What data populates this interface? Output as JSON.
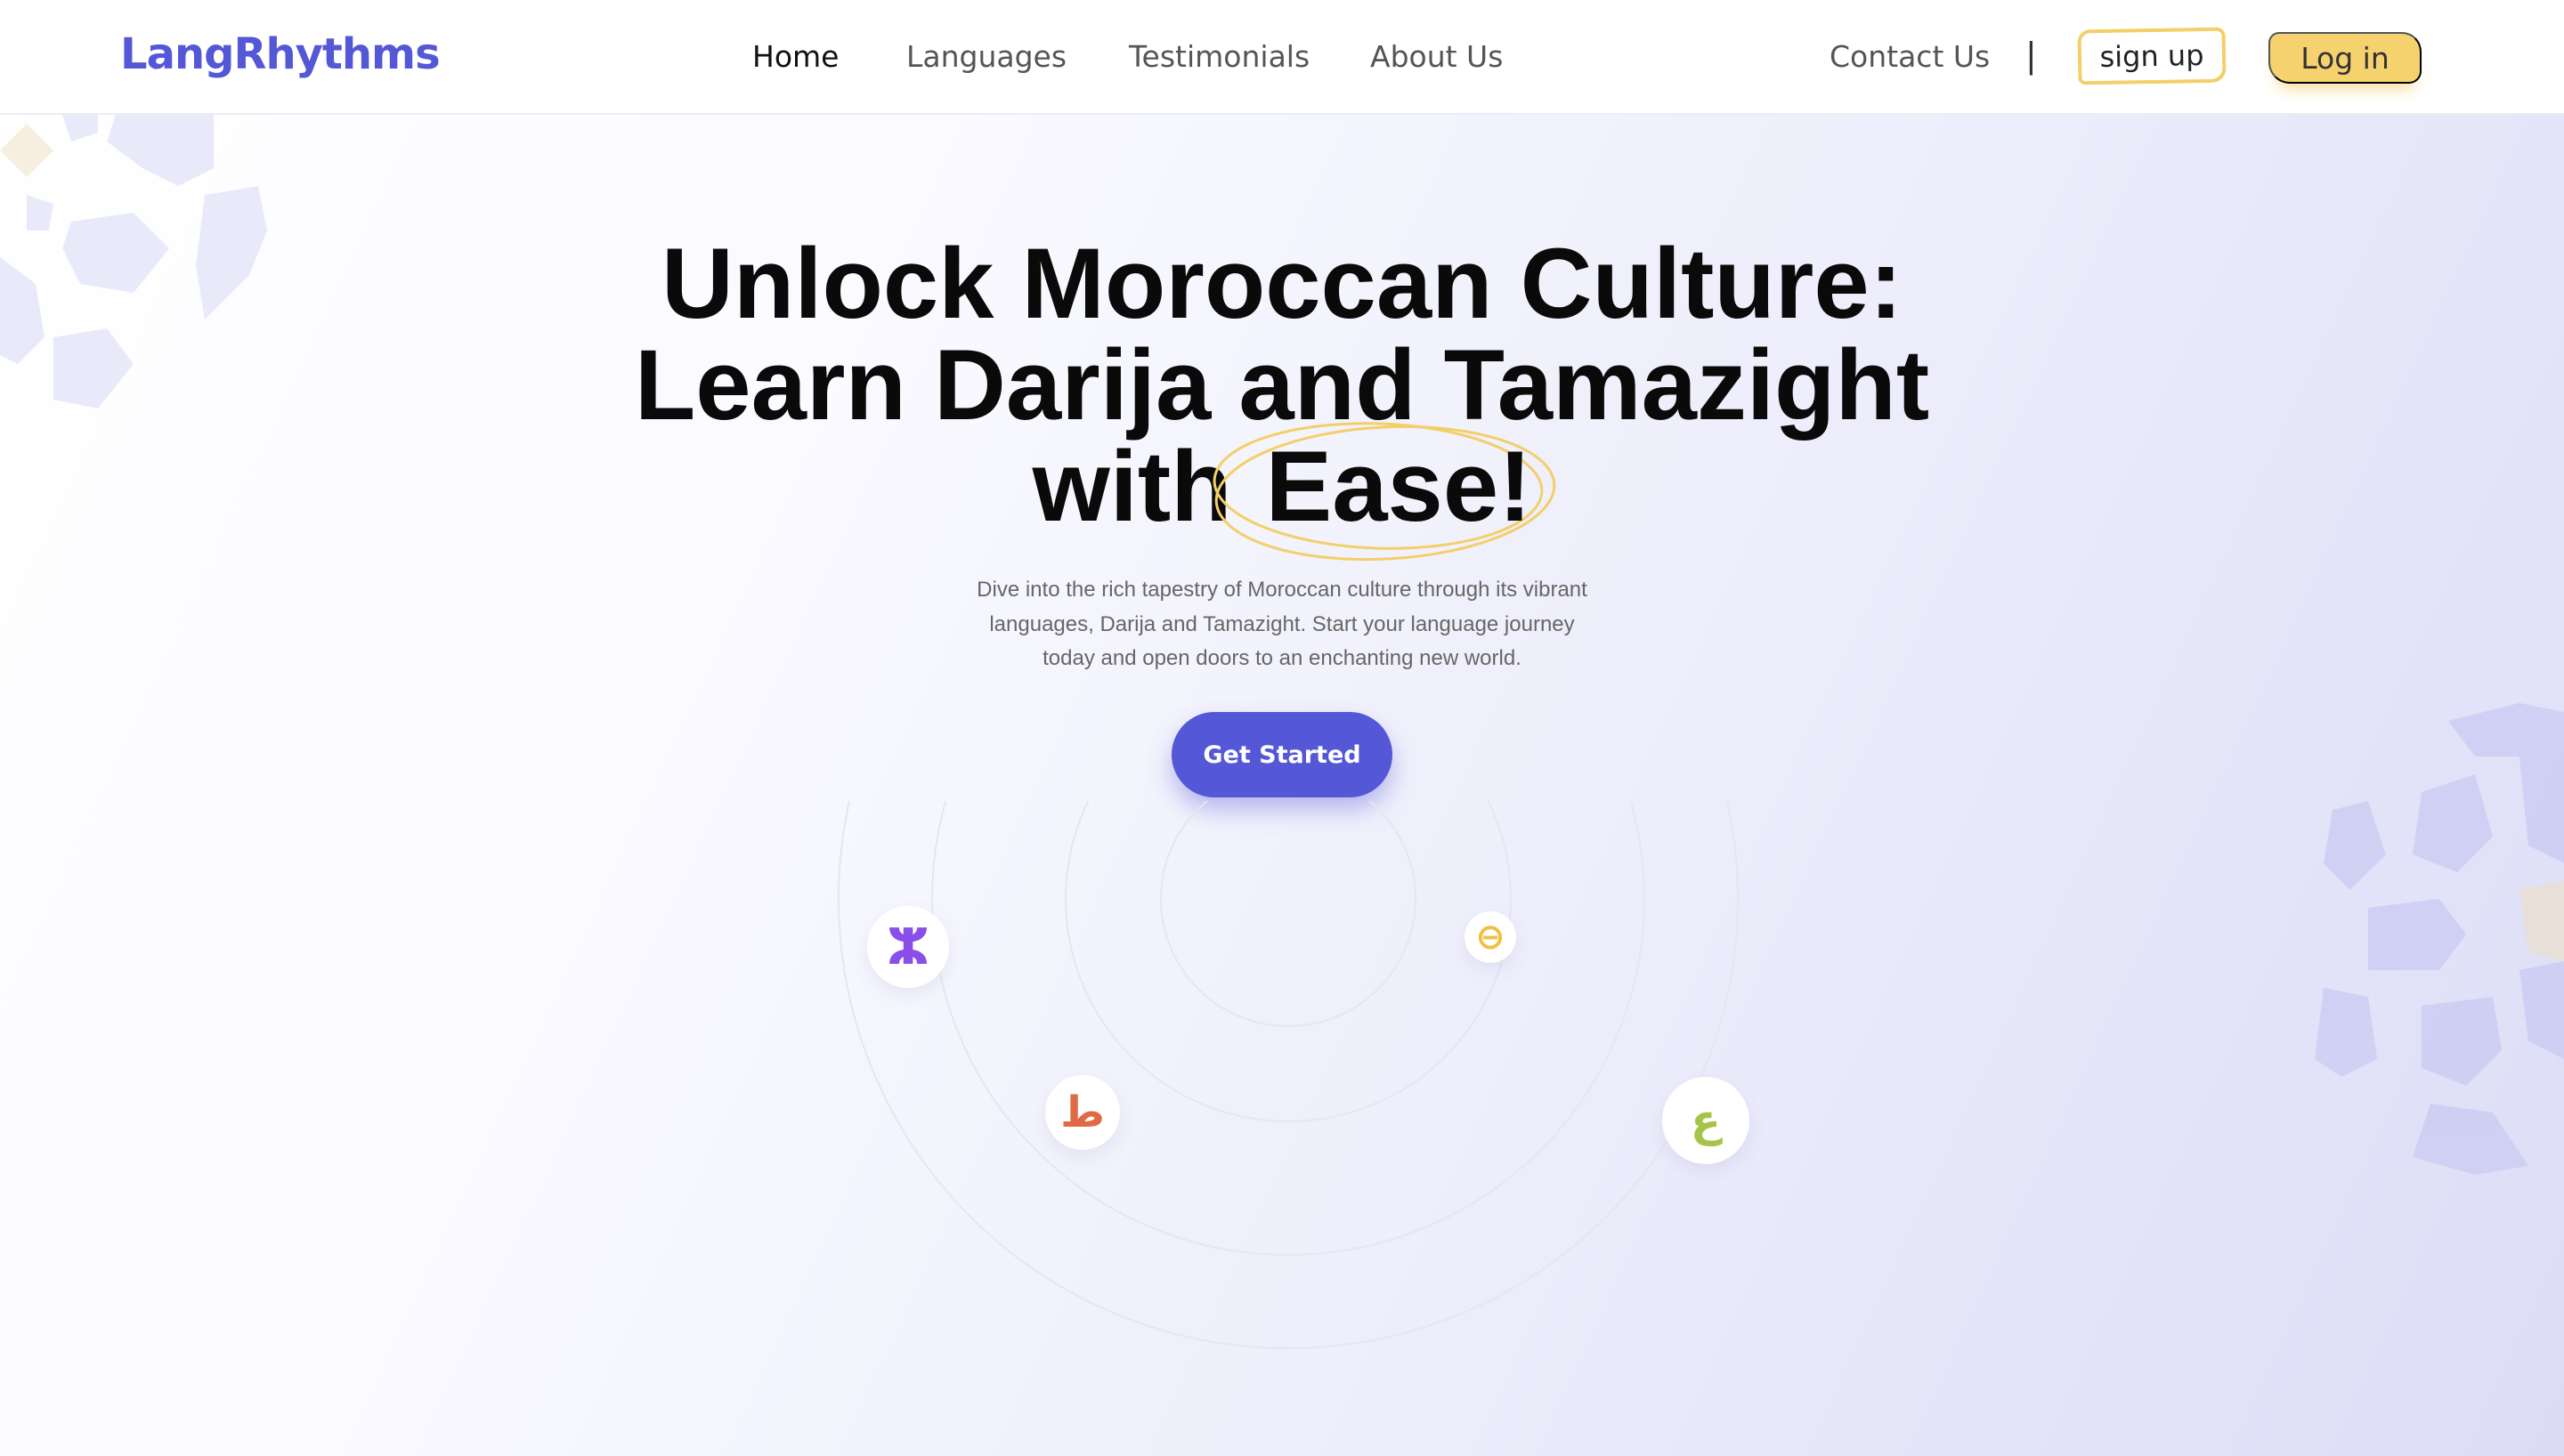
{
  "header": {
    "logo": "LangRhythms",
    "nav": [
      {
        "label": "Home",
        "active": true
      },
      {
        "label": "Languages",
        "active": false
      },
      {
        "label": "Testimonials",
        "active": false
      },
      {
        "label": "About Us",
        "active": false
      }
    ],
    "contact_label": "Contact Us",
    "separator": "|",
    "signup_label": "sign up",
    "login_label": "Log in"
  },
  "hero": {
    "title_line1": "Unlock Moroccan Culture:",
    "title_line2": "Learn Darija and Tamazight",
    "title_line3_prefix": "with",
    "title_highlight": "Ease!",
    "subtitle_line1": "Dive into the rich tapestry of Moroccan culture through its vibrant",
    "subtitle_line2": "languages, Darija and Tamazight. Start your language journey",
    "subtitle_line3": "today and open doors to an enchanting new world.",
    "cta_label": "Get Started"
  },
  "orbit_icons": [
    {
      "name": "tifinagh-yaz-icon",
      "glyph": "ⵣ",
      "color": "#8a4fe8"
    },
    {
      "name": "circle-minus-icon",
      "glyph": "⊖",
      "color": "#f0c040"
    },
    {
      "name": "arabic-taa-icon",
      "glyph": "ط",
      "color": "#e06a45"
    },
    {
      "name": "arabic-ain-icon",
      "glyph": "ع",
      "color": "#a6c44a"
    }
  ],
  "colors": {
    "brand": "#5558d6",
    "accent_yellow": "#f6d26f",
    "text_dark": "#0a0a0a",
    "text_muted": "#666666"
  }
}
